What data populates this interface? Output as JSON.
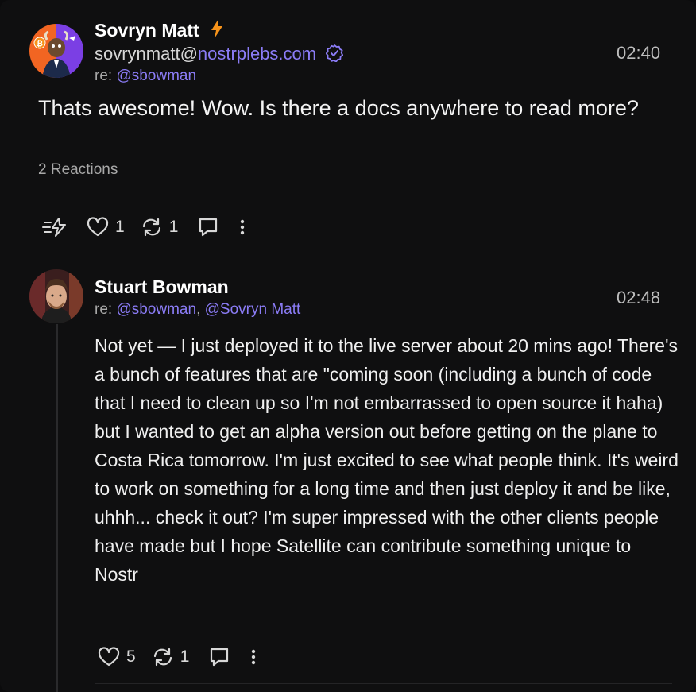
{
  "post1": {
    "author_name": "Sovryn Matt",
    "nip05_user": "sovrynmatt@",
    "nip05_domain": "nostrplebs.com",
    "reply_prefix": "re: ",
    "reply_mention": "@sbowman",
    "time": "02:40",
    "content": "Thats awesome! Wow. Is there a docs anywhere to read more?",
    "reactions_label": "2 Reactions",
    "like_count": "1",
    "repost_count": "1"
  },
  "post2": {
    "author_name": "Stuart Bowman",
    "reply_prefix": "re: ",
    "reply_mention_1": "@sbowman",
    "reply_separator": ", ",
    "reply_mention_2": "@Sovryn Matt",
    "time": "02:48",
    "content": "Not yet — I just deployed it to the live server about 20 mins ago! There's a bunch of features that are \"coming soon (including a bunch of code that I need to clean up so I'm not embarrassed to open source it haha) but I wanted to get an alpha version out before getting on the plane to Costa Rica tomorrow. I'm just excited to see what people think. It's weird to work on something for a long time and then just deploy it and be like, uhhh... check it out? I'm super impressed with the other clients people have made but I hope Satellite can contribute something unique to Nostr",
    "like_count": "5",
    "repost_count": "1"
  },
  "icons": {
    "zap": "zap-icon",
    "lightning_badge": "lightning-icon",
    "verified": "verified-badge-icon",
    "like": "heart-icon",
    "repost": "repost-icon",
    "reply": "reply-icon",
    "more": "more-vertical-icon"
  },
  "colors": {
    "background": "#0f0f10",
    "mention": "#8b7cf6",
    "lightning": "#f7931a",
    "muted_text": "#a8a8a8"
  }
}
